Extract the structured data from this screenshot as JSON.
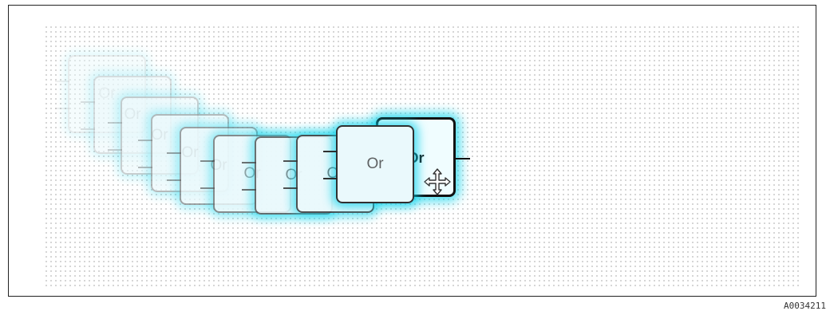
{
  "block": {
    "label": "Or"
  },
  "ghost_label": "Or",
  "cursor": {
    "icon": "move-cursor-icon"
  },
  "figure_id": "A0034211",
  "colors": {
    "glow": "#00d2eb",
    "block_fill": "#f0fdff",
    "border": "#111111"
  }
}
